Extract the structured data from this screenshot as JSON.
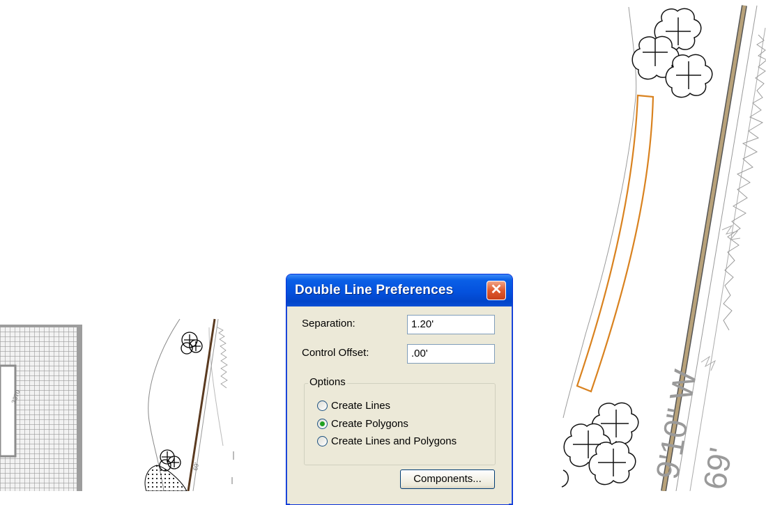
{
  "dialog": {
    "title": "Double Line Preferences",
    "close_glyph": "✕",
    "separation_label": "Separation:",
    "separation_value": "1.20'",
    "control_offset_label": "Control Offset:",
    "control_offset_value": ".00'",
    "options_group_label": "Options",
    "options": [
      {
        "label": "Create Lines",
        "selected": false
      },
      {
        "label": "Create Polygons",
        "selected": true
      },
      {
        "label": "Create Lines and Polygons",
        "selected": false
      }
    ],
    "components_button": "Components..."
  },
  "map_labels": {
    "bearing_text": "9'10\" W",
    "distance_text": "69'",
    "small_distance_text": "69'"
  },
  "colors": {
    "titlebar": "#0451dd",
    "close_button": "#e05a2e",
    "polygon_outline": "#d9821f",
    "road_line": "#b8a27a",
    "small_road_line": "#5a3a20"
  }
}
